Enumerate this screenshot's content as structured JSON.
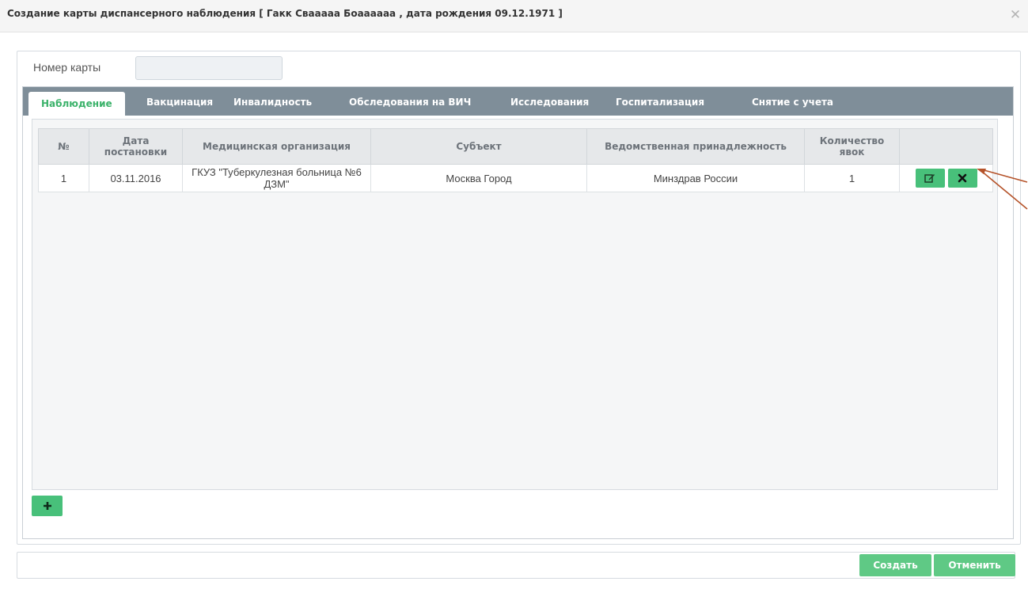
{
  "window": {
    "title": "Создание карты диспансерного наблюдения [ Гакк Свааааа Боаааааа , дата рождения 09.12.1971 ]",
    "close_icon": "close-icon"
  },
  "card": {
    "label": "Номер карты",
    "value": "",
    "placeholder": ""
  },
  "tabs": [
    {
      "label": "Наблюдение",
      "active": true
    },
    {
      "label": "Вакцинация",
      "active": false
    },
    {
      "label": "Инвалидность",
      "active": false
    },
    {
      "label": "Обследования на ВИЧ",
      "active": false
    },
    {
      "label": "Исследования",
      "active": false
    },
    {
      "label": "Госпитализация",
      "active": false
    },
    {
      "label": "Снятие с учета",
      "active": false
    }
  ],
  "table": {
    "columns": [
      "№",
      "Дата постановки",
      "Медицинская организация",
      "Субъект",
      "Ведомственная принадлежность",
      "Количество явок",
      ""
    ],
    "rows": [
      {
        "num": "1",
        "date": "03.11.2016",
        "org": "ГКУЗ \"Туберкулезная больница №6 ДЗМ\"",
        "subject": "Москва Город",
        "dept": "Минздрав России",
        "count": "1",
        "edit_icon": "edit-icon",
        "delete_icon": "delete-icon"
      }
    ]
  },
  "add_icon": "plus-icon",
  "footer": {
    "create_label": "Создать",
    "cancel_label": "Отменить"
  },
  "colors": {
    "accent_green": "#48c07a",
    "tab_bar": "#7f8e99",
    "arrow": "#b5532a"
  }
}
